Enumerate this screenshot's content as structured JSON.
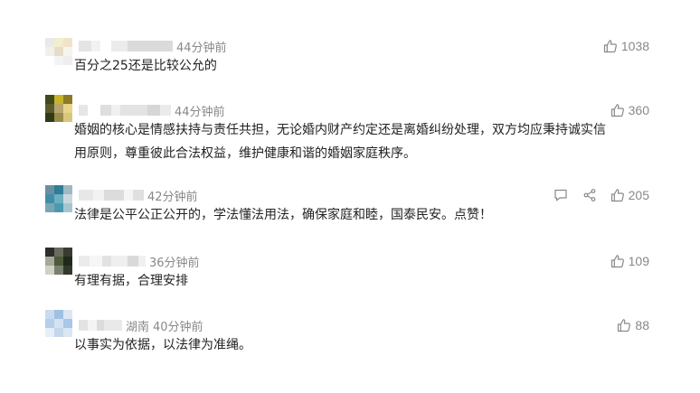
{
  "comments": [
    {
      "time": "44分钟前",
      "location": "",
      "text": "百分之25还是比较公允的",
      "likes": "1038",
      "avatar": [
        "#e9e9e9",
        "#f3eccf",
        "#efe3c8",
        "#f1f1ea",
        "#e6ddc8",
        "#f7f4ec",
        "#ffffff",
        "#f4f4f4",
        "#eeeeee"
      ],
      "show_reply_share": false
    },
    {
      "time": "44分钟前",
      "location": "",
      "text": "婚姻的核心是情感扶持与责任共担，无论婚内财产约定还是离婚纠纷处理，双方均应秉持诚实信\n用原则，尊重彼此合法权益，维护健康和谐的婚姻家庭秩序。",
      "likes": "360",
      "avatar": [
        "#3f4a1d",
        "#c9b12a",
        "#8c7a24",
        "#5b5a2c",
        "#b6a46c",
        "#e8d58a",
        "#2f3a18",
        "#9a8c48",
        "#d9c77d"
      ],
      "show_reply_share": false
    },
    {
      "time": "42分钟前",
      "location": "",
      "text": "法律是公平公正公开的，学法懂法用法，确保家庭和睦，国泰民安。点赞！",
      "likes": "205",
      "avatar": [
        "#6a8fa3",
        "#2f7d96",
        "#9fb8c2",
        "#3f8fa9",
        "#6bb0bf",
        "#c9d8de",
        "#7aa6b2",
        "#4b9ab0",
        "#a5c6cf"
      ],
      "show_reply_share": true
    },
    {
      "time": "36分钟前",
      "location": "",
      "text": "有理有据，合理安排",
      "likes": "109",
      "avatar": [
        "#2d2d2d",
        "#6b6b5d",
        "#3a3a30",
        "#a6a89b",
        "#4b5a3a",
        "#1f2a1c",
        "#cfd2c6",
        "#7a806e",
        "#303a2a"
      ],
      "show_reply_share": false
    },
    {
      "time": "40分钟前",
      "location": "湖南",
      "text": "以事实为依据，以法律为准绳。",
      "likes": "88",
      "avatar": [
        "#c9dcef",
        "#9ec0e3",
        "#dbe7f3",
        "#b6cfe8",
        "#d4e3f1",
        "#a9c7e6",
        "#e6eef7",
        "#c3d7ec",
        "#d9e6f3"
      ],
      "show_reply_share": false
    }
  ],
  "icons": {
    "like": "thumbs-up-icon",
    "reply": "comment-icon",
    "share": "share-icon"
  },
  "colors": {
    "text": "#222222",
    "meta": "#888888"
  }
}
